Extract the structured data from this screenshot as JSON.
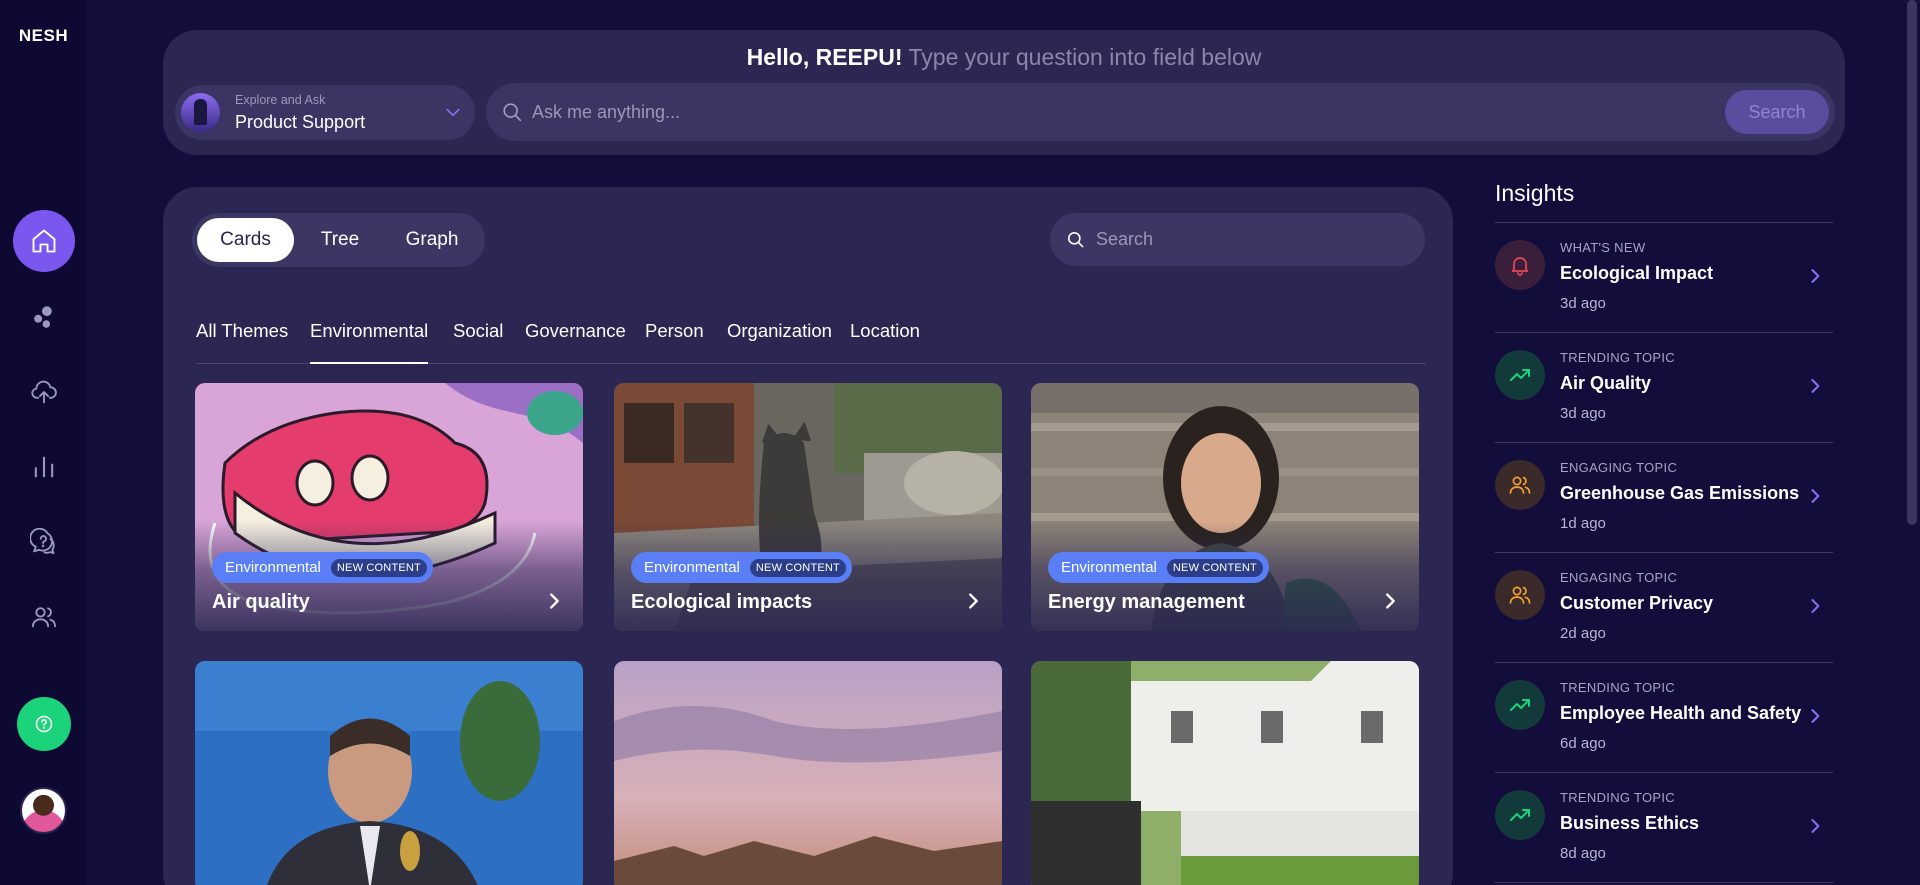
{
  "app": {
    "logo": "NESH"
  },
  "sidebar": {
    "items": [
      {
        "name": "home-icon",
        "active": true
      },
      {
        "name": "themes-icon",
        "active": false
      },
      {
        "name": "upload-icon",
        "active": false
      },
      {
        "name": "analytics-icon",
        "active": false
      },
      {
        "name": "questions-icon",
        "active": false
      },
      {
        "name": "users-icon",
        "active": false
      }
    ],
    "help_icon": "help-icon",
    "help_color": "#1ad37a",
    "accent": "#7b57f0"
  },
  "ask": {
    "hello": "Hello, REEPU!",
    "subtitle": "Type your question into field below",
    "mode_caption": "Explore and Ask",
    "mode_value": "Product Support",
    "placeholder": "Ask me anything...",
    "search_label": "Search"
  },
  "view": {
    "options": [
      "Cards",
      "Tree",
      "Graph"
    ],
    "active": "Cards",
    "search_placeholder": "Search"
  },
  "tabs": {
    "items": [
      "All Themes",
      "Environmental",
      "Social",
      "Governance",
      "Person",
      "Organization",
      "Location"
    ],
    "active": "Environmental"
  },
  "cards": [
    {
      "title": "Air quality",
      "theme": "Environmental",
      "badge": "NEW CONTENT"
    },
    {
      "title": "Ecological impacts",
      "theme": "Environmental",
      "badge": "NEW CONTENT"
    },
    {
      "title": "Energy management",
      "theme": "Environmental",
      "badge": "NEW CONTENT"
    },
    {
      "title": "",
      "theme": "",
      "badge": ""
    },
    {
      "title": "",
      "theme": "",
      "badge": ""
    },
    {
      "title": "",
      "theme": "",
      "badge": ""
    }
  ],
  "insights": {
    "title": "Insights",
    "items": [
      {
        "kicker": "WHAT'S NEW",
        "title": "Ecological Impact",
        "time": "3d ago",
        "icon": "bell-icon",
        "color": "#e8445a"
      },
      {
        "kicker": "TRENDING TOPIC",
        "title": "Air Quality",
        "time": "3d ago",
        "icon": "trending-up-icon",
        "color": "#1ad37a"
      },
      {
        "kicker": "ENGAGING TOPIC",
        "title": "Greenhouse Gas Emissions",
        "time": "1d ago",
        "icon": "people-icon",
        "color": "#f5a030"
      },
      {
        "kicker": "ENGAGING TOPIC",
        "title": "Customer Privacy",
        "time": "2d ago",
        "icon": "people-icon",
        "color": "#f5a030"
      },
      {
        "kicker": "TRENDING TOPIC",
        "title": "Employee Health and Safety",
        "time": "6d ago",
        "icon": "trending-up-icon",
        "color": "#1ad37a"
      },
      {
        "kicker": "TRENDING TOPIC",
        "title": "Business Ethics",
        "time": "8d ago",
        "icon": "trending-up-icon",
        "color": "#1ad37a"
      }
    ]
  }
}
